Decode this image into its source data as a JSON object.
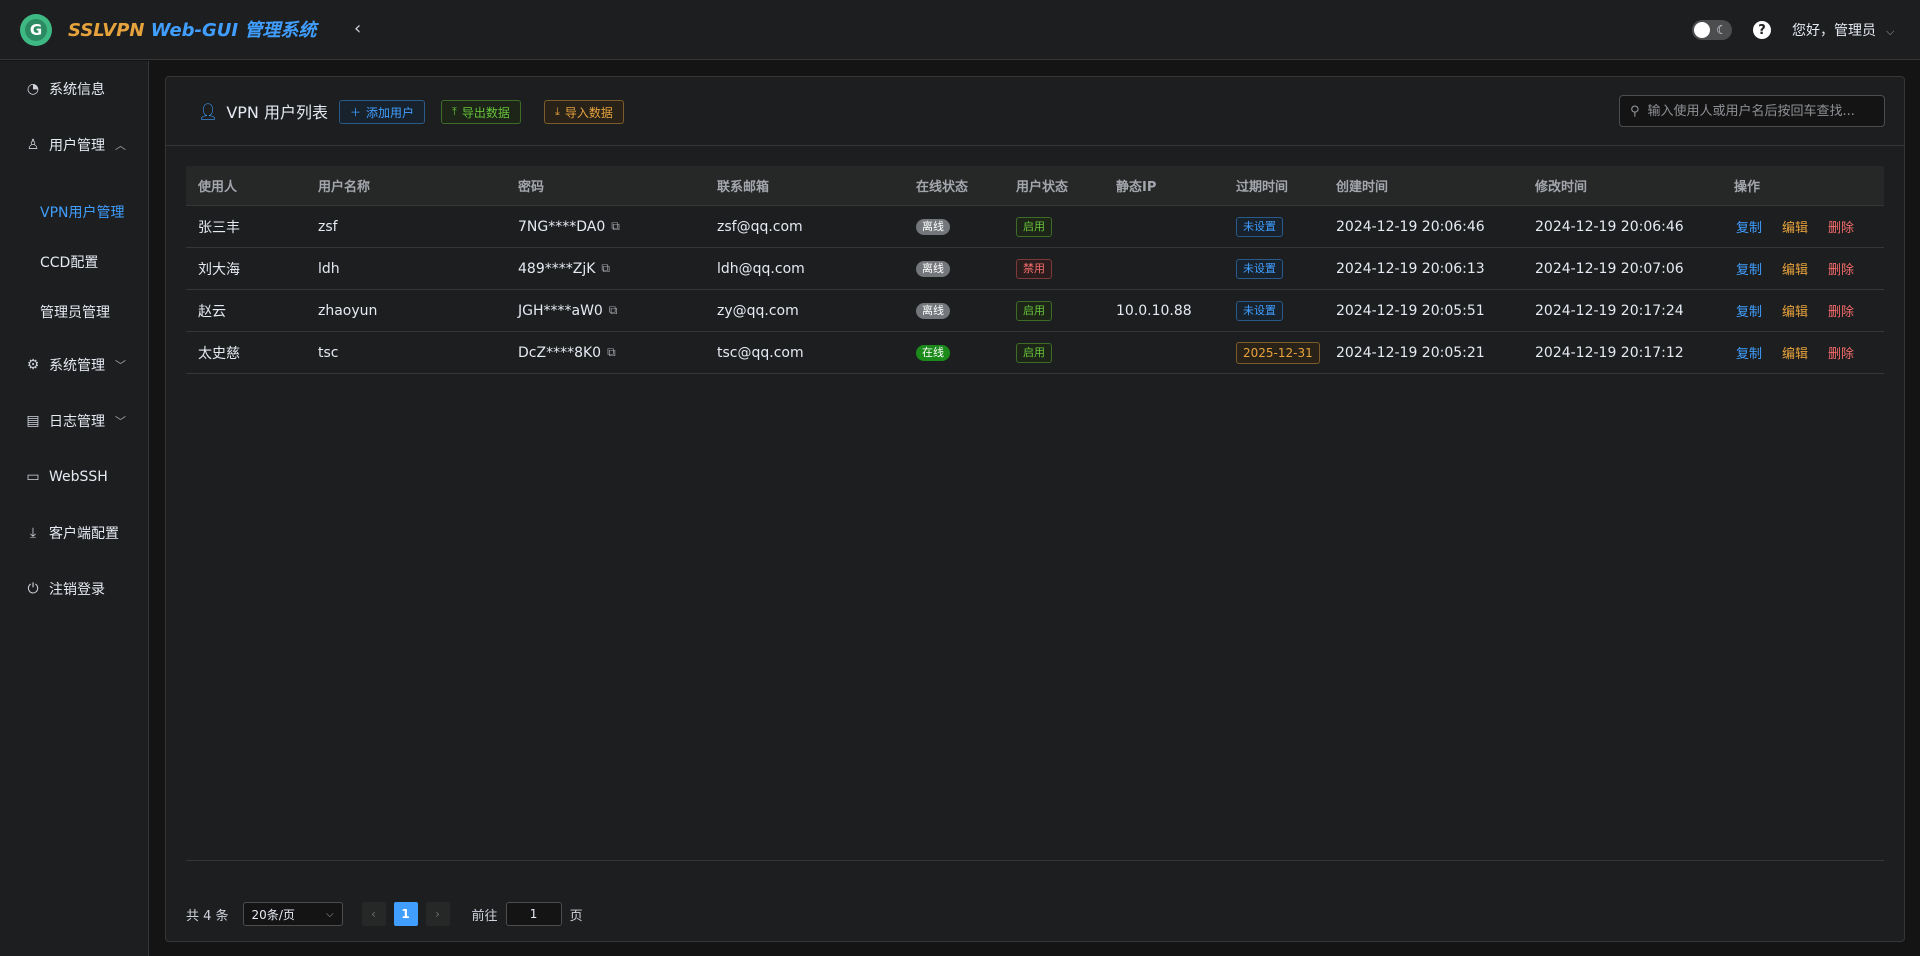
{
  "header": {
    "brand_part1": "SSLVPN",
    "brand_part2": " Web-GUI 管理系统",
    "greeting": "您好，管理员"
  },
  "sidebar": {
    "items": [
      {
        "label": "系统信息",
        "icon": "dashboard-icon"
      },
      {
        "label": "用户管理",
        "icon": "user-icon"
      },
      {
        "label": "系统管理",
        "icon": "gear-icon"
      },
      {
        "label": "日志管理",
        "icon": "document-icon"
      },
      {
        "label": "WebSSH",
        "icon": "monitor-icon"
      },
      {
        "label": "客户端配置",
        "icon": "download-icon"
      },
      {
        "label": "注销登录",
        "icon": "power-icon"
      }
    ],
    "sub_items": [
      {
        "label": "VPN用户管理",
        "active": true
      },
      {
        "label": "CCD配置",
        "active": false
      },
      {
        "label": "管理员管理",
        "active": false
      }
    ]
  },
  "main": {
    "title": "VPN 用户列表",
    "buttons": {
      "add": "添加用户",
      "export": "导出数据",
      "import": "导入数据"
    },
    "search_placeholder": "输入使用人或用户名后按回车查找..."
  },
  "table": {
    "columns": [
      "使用人",
      "用户名称",
      "密码",
      "联系邮箱",
      "在线状态",
      "用户状态",
      "静态IP",
      "过期时间",
      "创建时间",
      "修改时间",
      "操作"
    ],
    "rows": [
      {
        "owner": "张三丰",
        "username": "zsf",
        "password": "7NG****DA0",
        "email": "zsf@qq.com",
        "online": "离线",
        "status": "启用",
        "static_ip": "",
        "expire": "未设置",
        "created": "2024-12-19 20:06:46",
        "modified": "2024-12-19 20:06:46"
      },
      {
        "owner": "刘大海",
        "username": "ldh",
        "password": "489****ZjK",
        "email": "ldh@qq.com",
        "online": "离线",
        "status": "禁用",
        "static_ip": "",
        "expire": "未设置",
        "created": "2024-12-19 20:06:13",
        "modified": "2024-12-19 20:07:06"
      },
      {
        "owner": "赵云",
        "username": "zhaoyun",
        "password": "JGH****aW0",
        "email": "zy@qq.com",
        "online": "离线",
        "status": "启用",
        "static_ip": "10.0.10.88",
        "expire": "未设置",
        "created": "2024-12-19 20:05:51",
        "modified": "2024-12-19 20:17:24"
      },
      {
        "owner": "太史慈",
        "username": "tsc",
        "password": "DcZ****8K0",
        "email": "tsc@qq.com",
        "online": "在线",
        "status": "启用",
        "static_ip": "",
        "expire": "2025-12-31",
        "created": "2024-12-19 20:05:21",
        "modified": "2024-12-19 20:17:12"
      }
    ],
    "actions": {
      "copy": "复制",
      "edit": "编辑",
      "delete": "删除"
    }
  },
  "pagination": {
    "total": "共 4 条",
    "page_size": "20条/页",
    "current_page": "1",
    "goto_label": "前往",
    "goto_value": "1",
    "page_suffix": "页"
  },
  "colors": {
    "primary": "#409eff",
    "success": "#67c23a",
    "warning": "#e6a23c",
    "danger": "#f56c6c",
    "background": "#141414"
  }
}
